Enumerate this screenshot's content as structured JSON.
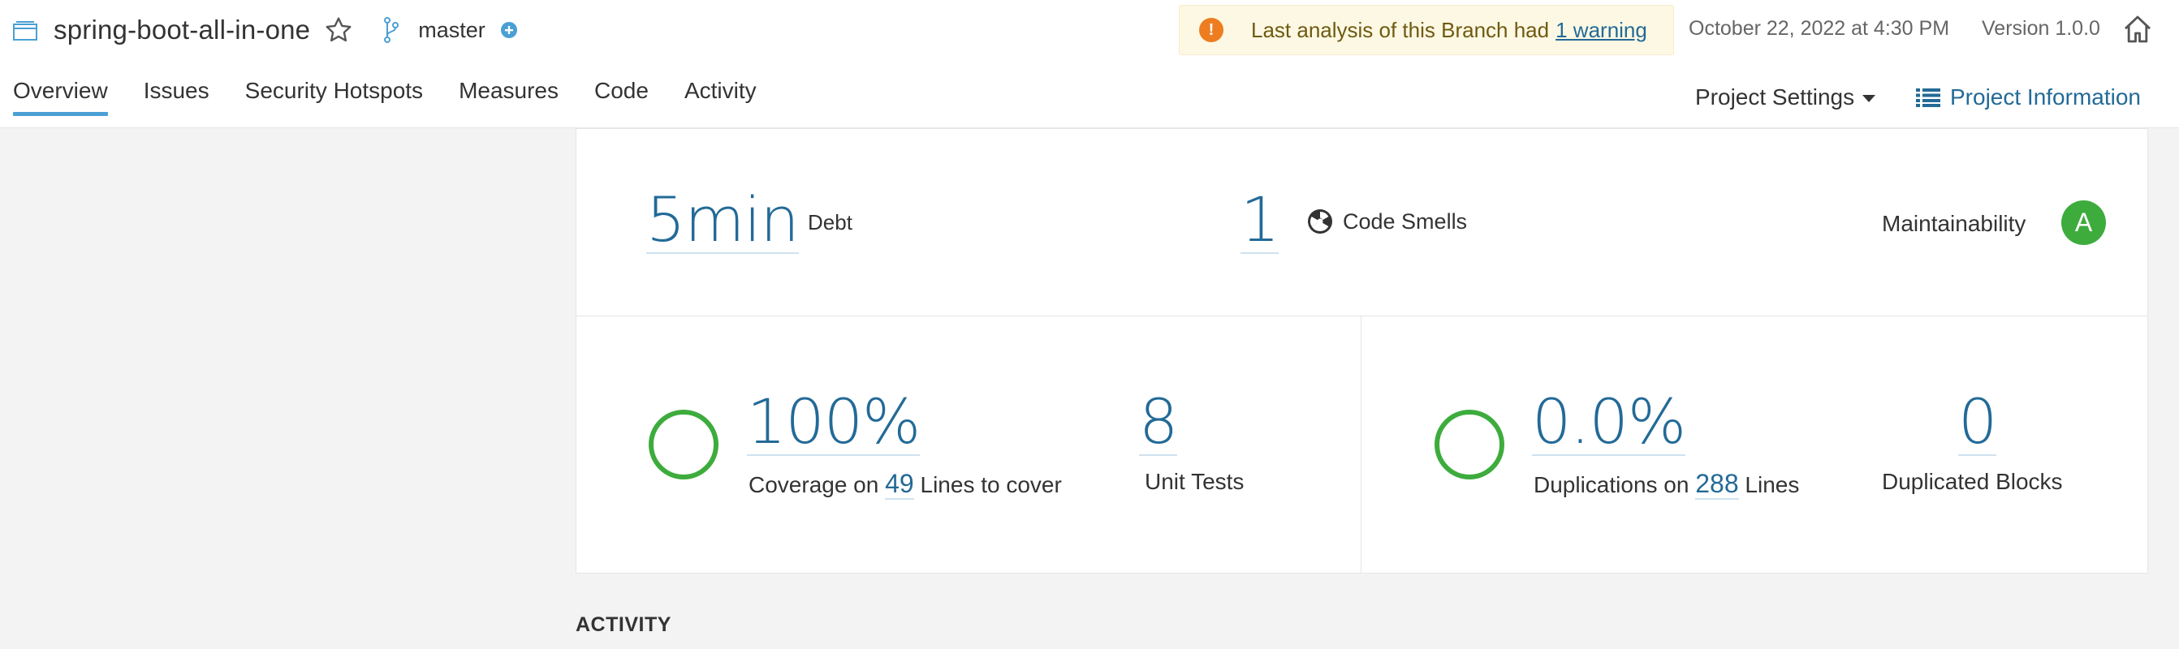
{
  "header": {
    "project_name": "spring-boot-all-in-one",
    "branch": "master",
    "warning": {
      "text": "Last analysis of this Branch had",
      "link": "1 warning"
    },
    "analysis_date": "October 22, 2022 at 4:30 PM",
    "version": "Version 1.0.0"
  },
  "nav": {
    "tabs": [
      {
        "label": "Overview",
        "active": true
      },
      {
        "label": "Issues"
      },
      {
        "label": "Security Hotspots"
      },
      {
        "label": "Measures"
      },
      {
        "label": "Code"
      },
      {
        "label": "Activity"
      }
    ],
    "project_settings": "Project Settings",
    "project_information": "Project Information"
  },
  "maintainability": {
    "debt_value": "5min",
    "debt_label": "Debt",
    "smells_value": "1",
    "smells_label": "Code Smells",
    "label": "Maintainability",
    "rating": "A"
  },
  "coverage": {
    "value": "100%",
    "prefix": "Coverage on",
    "lines": "49",
    "suffix": "Lines to cover",
    "unit_tests_value": "8",
    "unit_tests_label": "Unit Tests"
  },
  "duplications": {
    "value": "0.0%",
    "prefix": "Duplications on",
    "lines": "288",
    "suffix": "Lines",
    "blocks_value": "0",
    "blocks_label": "Duplicated Blocks"
  },
  "activity_heading": "ACTIVITY",
  "colors": {
    "accent": "#236a97",
    "rating_a": "#3dac3d",
    "warning_bg": "#fcf8e3",
    "warning_icon": "#ed7d20",
    "active_tab": "#4b9fd5"
  }
}
